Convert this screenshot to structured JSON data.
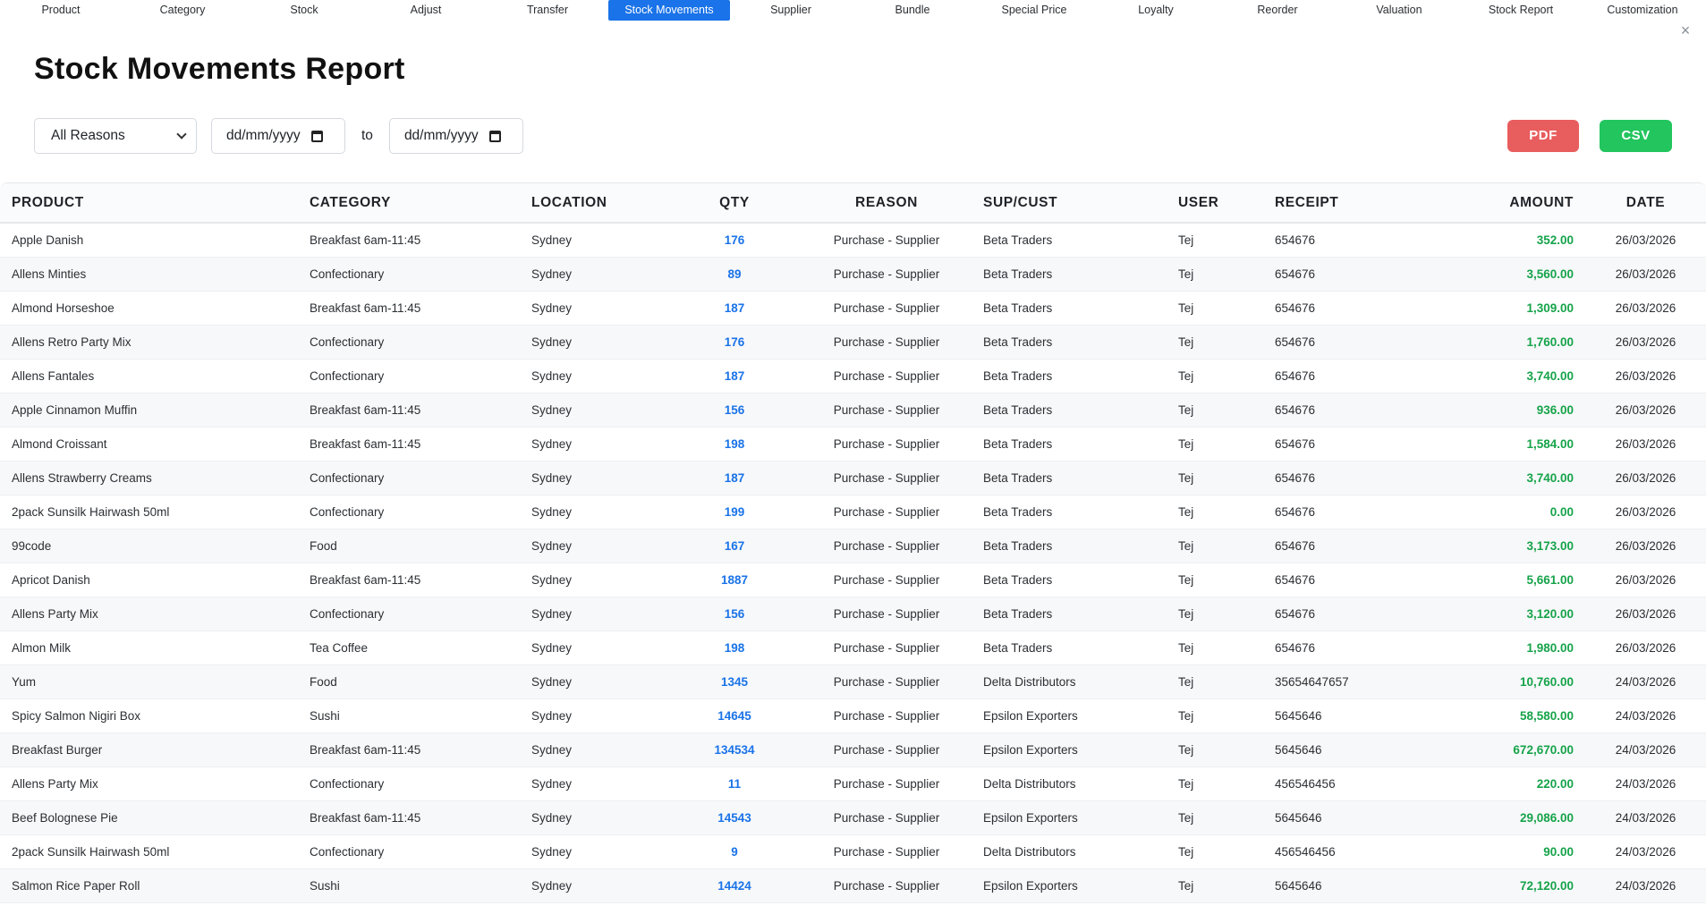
{
  "nav": {
    "tabs": [
      {
        "label": "Product",
        "active": false
      },
      {
        "label": "Category",
        "active": false
      },
      {
        "label": "Stock",
        "active": false
      },
      {
        "label": "Adjust",
        "active": false
      },
      {
        "label": "Transfer",
        "active": false
      },
      {
        "label": "Stock Movements",
        "active": true
      },
      {
        "label": "Supplier",
        "active": false
      },
      {
        "label": "Bundle",
        "active": false
      },
      {
        "label": "Special Price",
        "active": false
      },
      {
        "label": "Loyalty",
        "active": false
      },
      {
        "label": "Reorder",
        "active": false
      },
      {
        "label": "Valuation",
        "active": false
      },
      {
        "label": "Stock Report",
        "active": false
      },
      {
        "label": "Customization",
        "active": false
      }
    ],
    "close_symbol": "×"
  },
  "page": {
    "title": "Stock Movements Report"
  },
  "filters": {
    "reason_selected": "All Reasons",
    "from_placeholder": "dd/mm/yyyy",
    "to_label": "to",
    "to_placeholder": "dd/mm/yyyy"
  },
  "actions": {
    "pdf_label": "PDF",
    "csv_label": "CSV"
  },
  "colors": {
    "accent": "#1a73e8",
    "pdf": "#e85d5d",
    "csv": "#22c55e",
    "amount": "#16a34a"
  },
  "table": {
    "headers": [
      "PRODUCT",
      "CATEGORY",
      "LOCATION",
      "QTY",
      "REASON",
      "SUP/CUST",
      "USER",
      "RECEIPT",
      "AMOUNT",
      "DATE"
    ],
    "rows": [
      [
        "Apple Danish",
        "Breakfast 6am-11:45",
        "Sydney",
        "176",
        "Purchase - Supplier",
        "Beta Traders",
        "Tej",
        "654676",
        "352.00",
        "26/03/2026"
      ],
      [
        "Allens Minties",
        "Confectionary",
        "Sydney",
        "89",
        "Purchase - Supplier",
        "Beta Traders",
        "Tej",
        "654676",
        "3,560.00",
        "26/03/2026"
      ],
      [
        "Almond Horseshoe",
        "Breakfast 6am-11:45",
        "Sydney",
        "187",
        "Purchase - Supplier",
        "Beta Traders",
        "Tej",
        "654676",
        "1,309.00",
        "26/03/2026"
      ],
      [
        "Allens Retro Party Mix",
        "Confectionary",
        "Sydney",
        "176",
        "Purchase - Supplier",
        "Beta Traders",
        "Tej",
        "654676",
        "1,760.00",
        "26/03/2026"
      ],
      [
        "Allens Fantales",
        "Confectionary",
        "Sydney",
        "187",
        "Purchase - Supplier",
        "Beta Traders",
        "Tej",
        "654676",
        "3,740.00",
        "26/03/2026"
      ],
      [
        "Apple Cinnamon Muffin",
        "Breakfast 6am-11:45",
        "Sydney",
        "156",
        "Purchase - Supplier",
        "Beta Traders",
        "Tej",
        "654676",
        "936.00",
        "26/03/2026"
      ],
      [
        "Almond Croissant",
        "Breakfast 6am-11:45",
        "Sydney",
        "198",
        "Purchase - Supplier",
        "Beta Traders",
        "Tej",
        "654676",
        "1,584.00",
        "26/03/2026"
      ],
      [
        "Allens Strawberry Creams",
        "Confectionary",
        "Sydney",
        "187",
        "Purchase - Supplier",
        "Beta Traders",
        "Tej",
        "654676",
        "3,740.00",
        "26/03/2026"
      ],
      [
        "2pack Sunsilk Hairwash 50ml",
        "Confectionary",
        "Sydney",
        "199",
        "Purchase - Supplier",
        "Beta Traders",
        "Tej",
        "654676",
        "0.00",
        "26/03/2026"
      ],
      [
        "99code",
        "Food",
        "Sydney",
        "167",
        "Purchase - Supplier",
        "Beta Traders",
        "Tej",
        "654676",
        "3,173.00",
        "26/03/2026"
      ],
      [
        "Apricot Danish",
        "Breakfast 6am-11:45",
        "Sydney",
        "1887",
        "Purchase - Supplier",
        "Beta Traders",
        "Tej",
        "654676",
        "5,661.00",
        "26/03/2026"
      ],
      [
        "Allens Party Mix",
        "Confectionary",
        "Sydney",
        "156",
        "Purchase - Supplier",
        "Beta Traders",
        "Tej",
        "654676",
        "3,120.00",
        "26/03/2026"
      ],
      [
        "Almon Milk",
        "Tea Coffee",
        "Sydney",
        "198",
        "Purchase - Supplier",
        "Beta Traders",
        "Tej",
        "654676",
        "1,980.00",
        "26/03/2026"
      ],
      [
        "Yum",
        "Food",
        "Sydney",
        "1345",
        "Purchase - Supplier",
        "Delta Distributors",
        "Tej",
        "35654647657",
        "10,760.00",
        "24/03/2026"
      ],
      [
        "Spicy Salmon Nigiri Box",
        "Sushi",
        "Sydney",
        "14645",
        "Purchase - Supplier",
        "Epsilon Exporters",
        "Tej",
        "5645646",
        "58,580.00",
        "24/03/2026"
      ],
      [
        "Breakfast Burger",
        "Breakfast 6am-11:45",
        "Sydney",
        "134534",
        "Purchase - Supplier",
        "Epsilon Exporters",
        "Tej",
        "5645646",
        "672,670.00",
        "24/03/2026"
      ],
      [
        "Allens Party Mix",
        "Confectionary",
        "Sydney",
        "11",
        "Purchase - Supplier",
        "Delta Distributors",
        "Tej",
        "456546456",
        "220.00",
        "24/03/2026"
      ],
      [
        "Beef Bolognese Pie",
        "Breakfast 6am-11:45",
        "Sydney",
        "14543",
        "Purchase - Supplier",
        "Epsilon Exporters",
        "Tej",
        "5645646",
        "29,086.00",
        "24/03/2026"
      ],
      [
        "2pack Sunsilk Hairwash 50ml",
        "Confectionary",
        "Sydney",
        "9",
        "Purchase - Supplier",
        "Delta Distributors",
        "Tej",
        "456546456",
        "90.00",
        "24/03/2026"
      ],
      [
        "Salmon Rice Paper Roll",
        "Sushi",
        "Sydney",
        "14424",
        "Purchase - Supplier",
        "Epsilon Exporters",
        "Tej",
        "5645646",
        "72,120.00",
        "24/03/2026"
      ]
    ]
  }
}
